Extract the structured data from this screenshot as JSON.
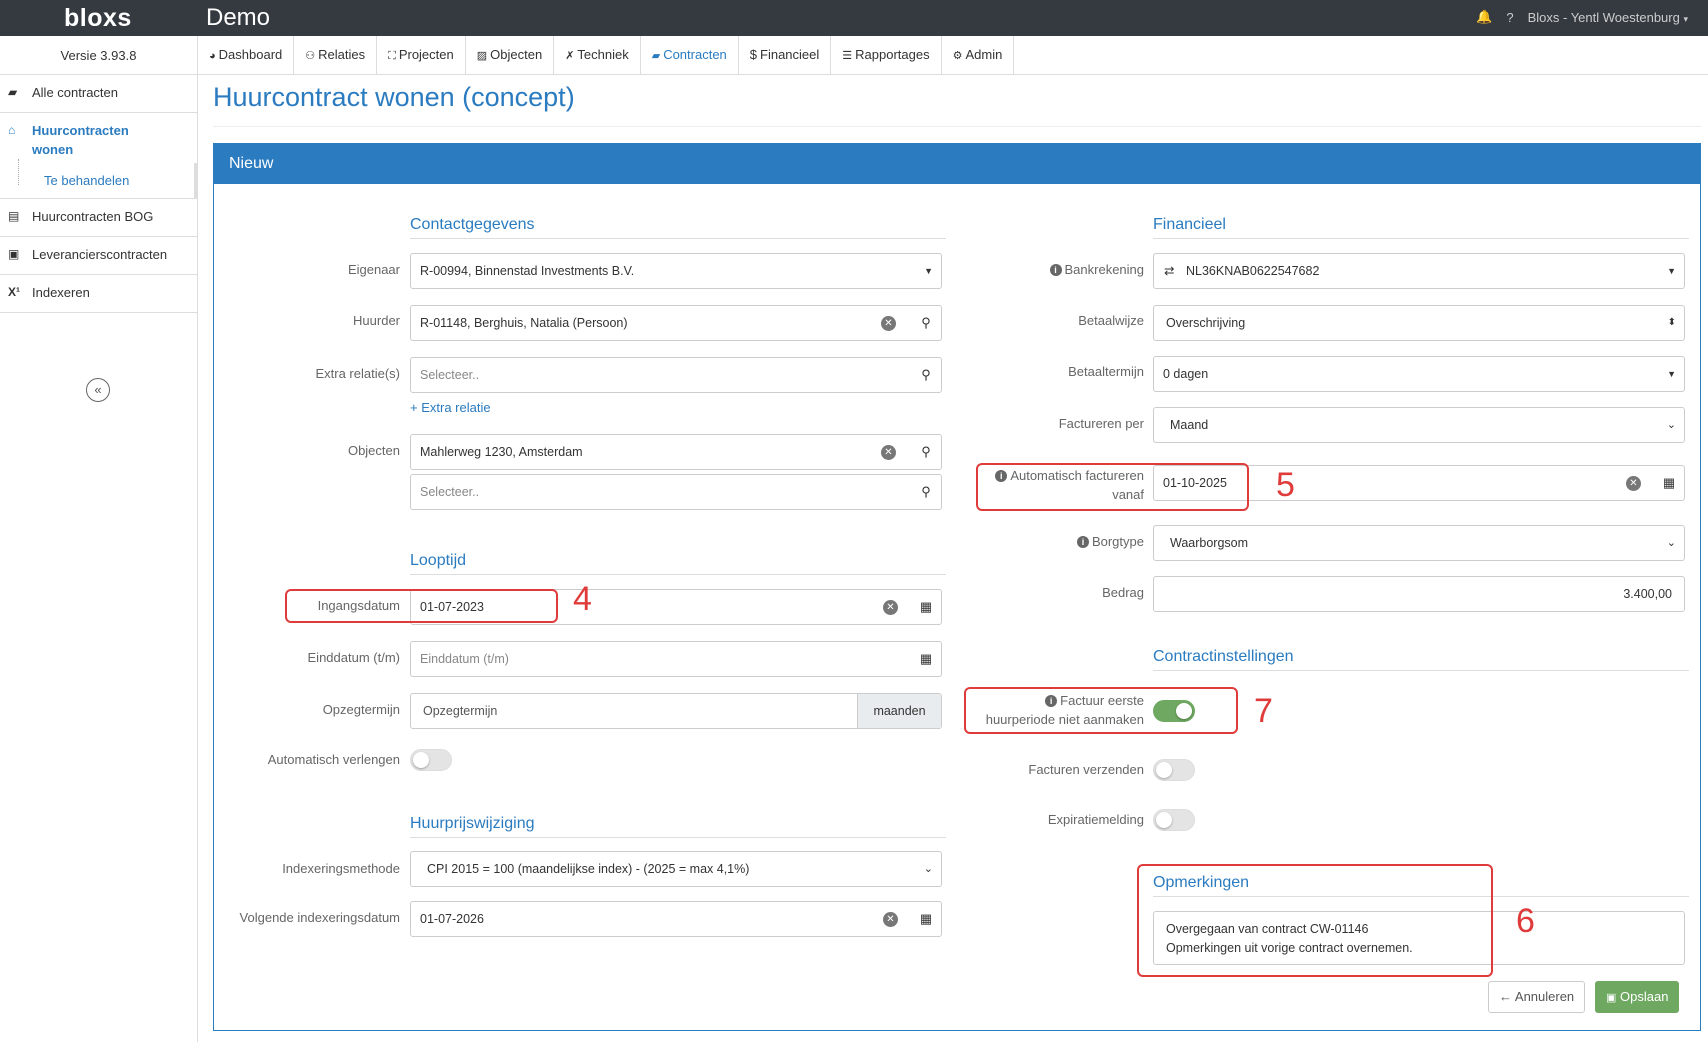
{
  "topbar": {
    "logo": "bloxs",
    "app_title": "Demo",
    "user": "Bloxs - Yentl Woestenburg",
    "bell_icon": "bell-icon",
    "help": "?"
  },
  "sidebar": {
    "version": "Versie 3.93.8",
    "items": [
      {
        "label": "Alle contracten",
        "icon": "folder-open-icon"
      },
      {
        "label": "Huurcontracten wonen",
        "icon": "home-icon"
      },
      {
        "label": "Te behandelen",
        "icon": ""
      },
      {
        "label": "Huurcontracten BOG",
        "icon": "building-icon"
      },
      {
        "label": "Leverancierscontracten",
        "icon": "briefcase-icon"
      },
      {
        "label": "Indexeren",
        "icon": "superscript-icon"
      }
    ],
    "collapse": "«"
  },
  "nav": [
    {
      "label": "Dashboard",
      "icon": "dashboard-icon"
    },
    {
      "label": "Relaties",
      "icon": "sitemap-icon"
    },
    {
      "label": "Projecten",
      "icon": "expand-icon"
    },
    {
      "label": "Objecten",
      "icon": "image-icon"
    },
    {
      "label": "Techniek",
      "icon": "tools-icon"
    },
    {
      "label": "Contracten",
      "icon": "folder-open-icon"
    },
    {
      "label": "Financieel",
      "icon": "dollar-icon"
    },
    {
      "label": "Rapportages",
      "icon": "list-icon"
    },
    {
      "label": "Admin",
      "icon": "cog-icon"
    }
  ],
  "page": {
    "title": "Huurcontract wonen (concept)",
    "panel_title": "Nieuw"
  },
  "contact": {
    "section": "Contactgegevens",
    "eigenaar_label": "Eigenaar",
    "eigenaar_value": "R-00994, Binnenstad Investments B.V.",
    "huurder_label": "Huurder",
    "huurder_value": "R-01148, Berghuis, Natalia (Persoon)",
    "extra_label": "Extra relatie(s)",
    "extra_placeholder": "Selecteer..",
    "extra_link": "+ Extra relatie",
    "objecten_label": "Objecten",
    "objecten_value": "Mahlerweg 1230, Amsterdam",
    "objecten_placeholder": "Selecteer.."
  },
  "looptijd": {
    "section": "Looptijd",
    "ingang_label": "Ingangsdatum",
    "ingang_value": "01-07-2023",
    "eind_label": "Einddatum (t/m)",
    "eind_placeholder": "Einddatum (t/m)",
    "opzeg_label": "Opzegtermijn",
    "opzeg_placeholder": "Opzegtermijn",
    "opzeg_addon": "maanden",
    "verlengen_label": "Automatisch verlengen",
    "verlengen_on": false
  },
  "huurprijs": {
    "section": "Huurprijswijziging",
    "methode_label": "Indexeringsmethode",
    "methode_value": "CPI 2015 = 100 (maandelijkse index) - (2025 = max 4,1%)",
    "volgende_label": "Volgende indexeringsdatum",
    "volgende_value": "01-07-2026"
  },
  "financieel": {
    "section": "Financieel",
    "bank_label": "Bankrekening",
    "bank_value": "NL36KNAB0622547682",
    "betaalwijze_label": "Betaalwijze",
    "betaalwijze_value": "Overschrijving",
    "betaaltermijn_label": "Betaaltermijn",
    "betaaltermijn_value": "0 dagen",
    "factureren_label": "Factureren per",
    "factureren_value": "Maand",
    "auto_label_1": "Automatisch factureren",
    "auto_label_2": "vanaf",
    "auto_value": "01-10-2025",
    "borg_label": "Borgtype",
    "borg_value": "Waarborgsom",
    "bedrag_label": "Bedrag",
    "bedrag_value": "3.400,00"
  },
  "instellingen": {
    "section": "Contractinstellingen",
    "eerste_label_1": "Factuur eerste",
    "eerste_label_2": "huurperiode niet aanmaken",
    "eerste_on": true,
    "verzenden_label": "Facturen verzenden",
    "verzenden_on": false,
    "expiratie_label": "Expiratiemelding",
    "expiratie_on": false
  },
  "opmerkingen": {
    "section": "Opmerkingen",
    "line1": "Overgegaan van contract CW-01146",
    "line2": "Opmerkingen uit vorige contract overnemen."
  },
  "actions": {
    "cancel": "← Annuleren",
    "save": "Opslaan"
  },
  "annotations": {
    "n4": "4",
    "n5": "5",
    "n6": "6",
    "n7": "7"
  },
  "colors": {
    "primary": "#2a7bc0",
    "topbar": "#343a40",
    "annotation": "#e03b3b",
    "save": "#6ea861"
  }
}
